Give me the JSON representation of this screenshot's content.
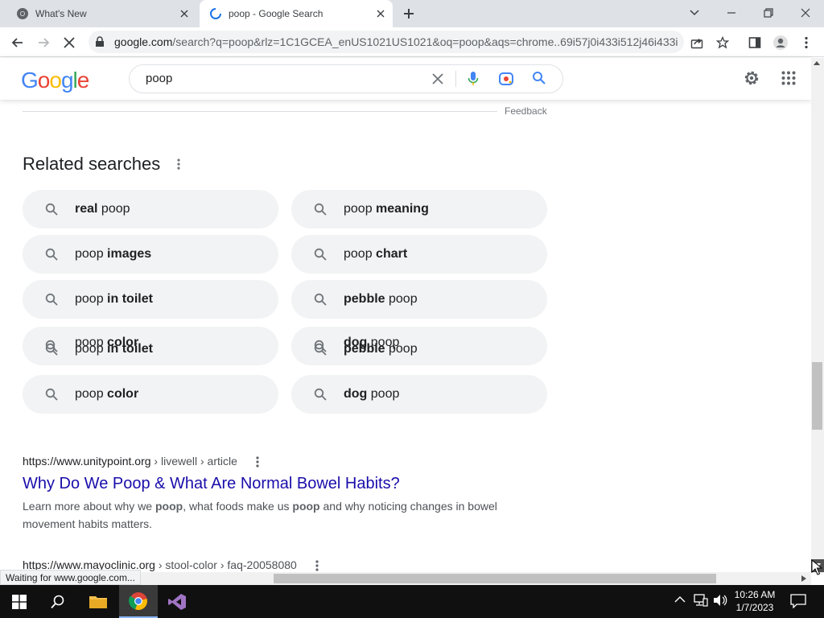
{
  "browser": {
    "tabs": [
      {
        "title": "What's New",
        "active": false
      },
      {
        "title": "poop - Google Search",
        "active": true
      }
    ],
    "url_domain": "google.com",
    "url_rest": "/search?q=poop&rlz=1C1GCEA_enUS1021US1021&oq=poop&aqs=chrome..69i57j0i433i512j46i433i...",
    "status_text": "Waiting for www.google.com..."
  },
  "google": {
    "logo": "Google",
    "search_query": "poop"
  },
  "content": {
    "feedback": "Feedback",
    "related_title": "Related searches",
    "chips": [
      {
        "pre": "",
        "bold": "real",
        "post": " poop"
      },
      {
        "pre": "poop ",
        "bold": "meaning",
        "post": ""
      },
      {
        "pre": "poop ",
        "bold": "images",
        "post": ""
      },
      {
        "pre": "poop ",
        "bold": "chart",
        "post": ""
      },
      {
        "pre": "poop ",
        "bold": "in toilet",
        "post": ""
      },
      {
        "pre": "",
        "bold": "pebble",
        "post": " poop"
      },
      {
        "pre": "poop ",
        "bold": "color",
        "post": ""
      },
      {
        "pre": "",
        "bold": "dog",
        "post": " poop"
      },
      {
        "pre": "poop ",
        "bold": "color",
        "post": ""
      },
      {
        "pre": "",
        "bold": "dog",
        "post": " poop"
      }
    ],
    "ghost_chips": [
      {
        "pre": "poop ",
        "bold": "in toilet",
        "post": ""
      },
      {
        "pre": "",
        "bold": "pebble",
        "post": " poop"
      }
    ],
    "results": [
      {
        "domain": "https://www.unitypoint.org",
        "path": " › livewell › article",
        "title": "Why Do We Poop & What Are Normal Bowel Habits?",
        "snippet_parts": [
          "Learn more about why we ",
          "poop",
          ", what foods make us ",
          "poop",
          " and why noticing changes in bowel movement habits matters."
        ]
      },
      {
        "domain": "https://www.mayoclinic.org",
        "path": " › stool-color › faq-20058080"
      }
    ]
  },
  "taskbar": {
    "time": "10:26 AM",
    "date": "1/7/2023"
  },
  "colors": {
    "link": "#1a0dab",
    "chip_bg": "#f1f3f4",
    "google_blue": "#4285f4",
    "google_red": "#ea4335",
    "google_yellow": "#fbbc05",
    "google_green": "#34a853"
  }
}
